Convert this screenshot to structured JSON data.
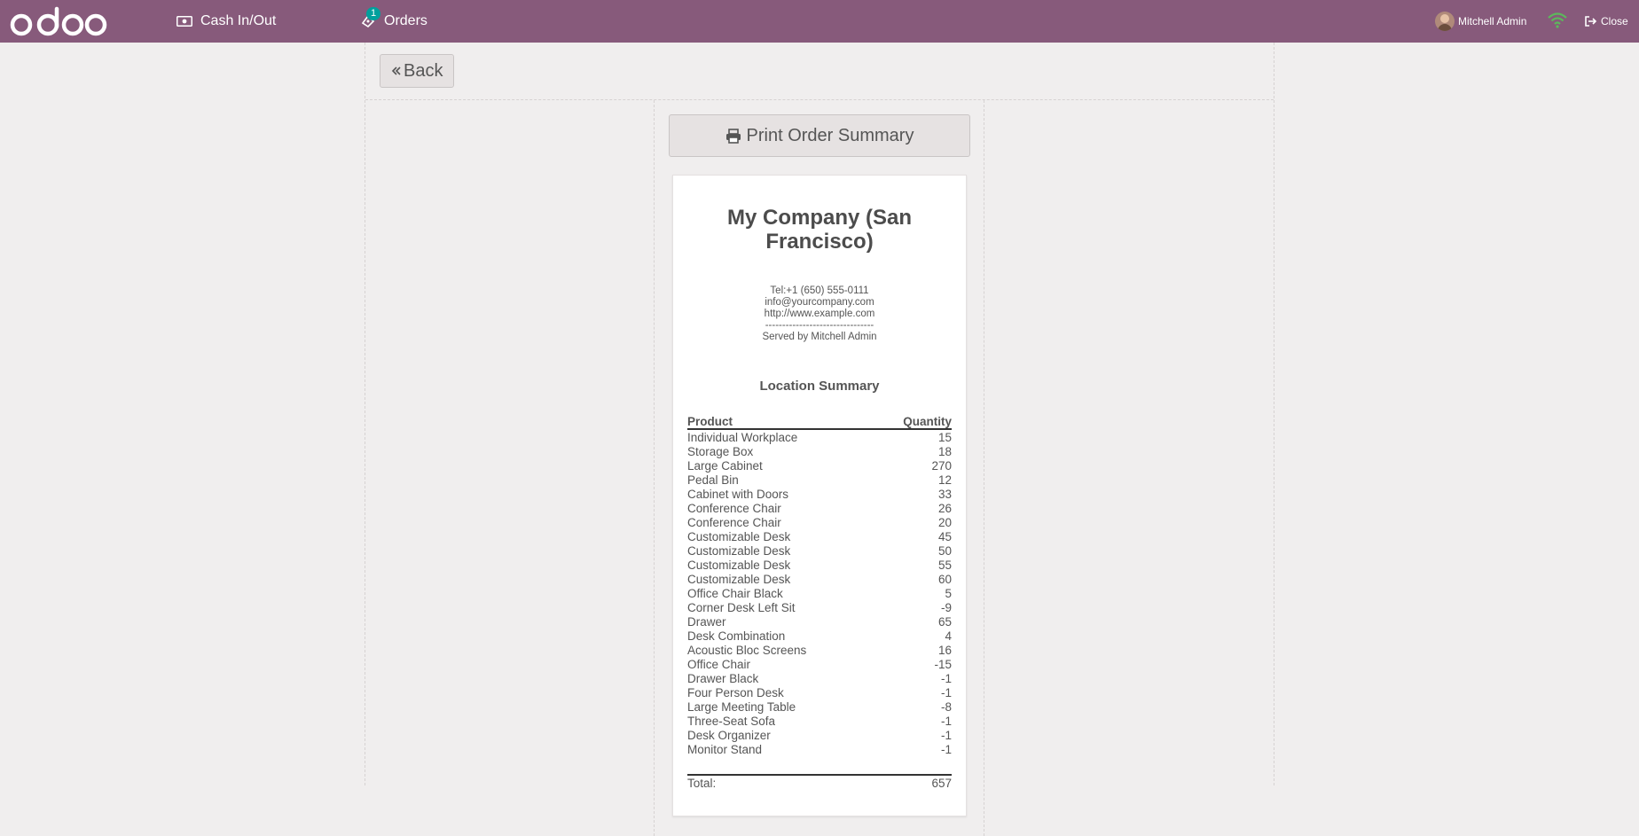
{
  "topbar": {
    "logo": "odoo",
    "cash_label": "Cash In/Out",
    "orders_label": "Orders",
    "orders_badge": "1",
    "user_name": "Mitchell Admin",
    "close_label": "Close"
  },
  "controls": {
    "back_label": "Back",
    "print_label": "Print Order Summary"
  },
  "receipt": {
    "company": "My Company (San Francisco)",
    "tel": "Tel:+1 (650) 555-0111",
    "email": "info@yourcompany.com",
    "website": "http://www.example.com",
    "separator": "--------------------------------",
    "served_by": "Served by Mitchell Admin",
    "section_title": "Location Summary",
    "col_product": "Product",
    "col_quantity": "Quantity",
    "lines": [
      {
        "product": "Individual Workplace",
        "qty": "15"
      },
      {
        "product": "Storage Box",
        "qty": "18"
      },
      {
        "product": "Large Cabinet",
        "qty": "270"
      },
      {
        "product": "Pedal Bin",
        "qty": "12"
      },
      {
        "product": "Cabinet with Doors",
        "qty": "33"
      },
      {
        "product": "Conference Chair",
        "qty": "26"
      },
      {
        "product": "Conference Chair",
        "qty": "20"
      },
      {
        "product": "Customizable Desk",
        "qty": "45"
      },
      {
        "product": "Customizable Desk",
        "qty": "50"
      },
      {
        "product": "Customizable Desk",
        "qty": "55"
      },
      {
        "product": "Customizable Desk",
        "qty": "60"
      },
      {
        "product": "Office Chair Black",
        "qty": "5"
      },
      {
        "product": "Corner Desk Left Sit",
        "qty": "-9"
      },
      {
        "product": "Drawer",
        "qty": "65"
      },
      {
        "product": "Desk Combination",
        "qty": "4"
      },
      {
        "product": "Acoustic Bloc Screens",
        "qty": "16"
      },
      {
        "product": "Office Chair",
        "qty": "-15"
      },
      {
        "product": "Drawer Black",
        "qty": "-1"
      },
      {
        "product": "Four Person Desk",
        "qty": "-1"
      },
      {
        "product": "Large Meeting Table",
        "qty": "-8"
      },
      {
        "product": "Three-Seat Sofa",
        "qty": "-1"
      },
      {
        "product": "Desk Organizer",
        "qty": "-1"
      },
      {
        "product": "Monitor Stand",
        "qty": "-1"
      }
    ],
    "total_label": "Total:",
    "total_value": "657"
  },
  "colors": {
    "topbar_bg": "#875a7b",
    "badge_bg": "#00a09d",
    "wifi": "#5cb85c"
  },
  "icons": {
    "cash": "money-icon",
    "orders": "ticket-icon",
    "back": "double-chevron-left-icon",
    "print": "printer-icon",
    "wifi": "wifi-icon",
    "close": "sign-out-icon"
  }
}
